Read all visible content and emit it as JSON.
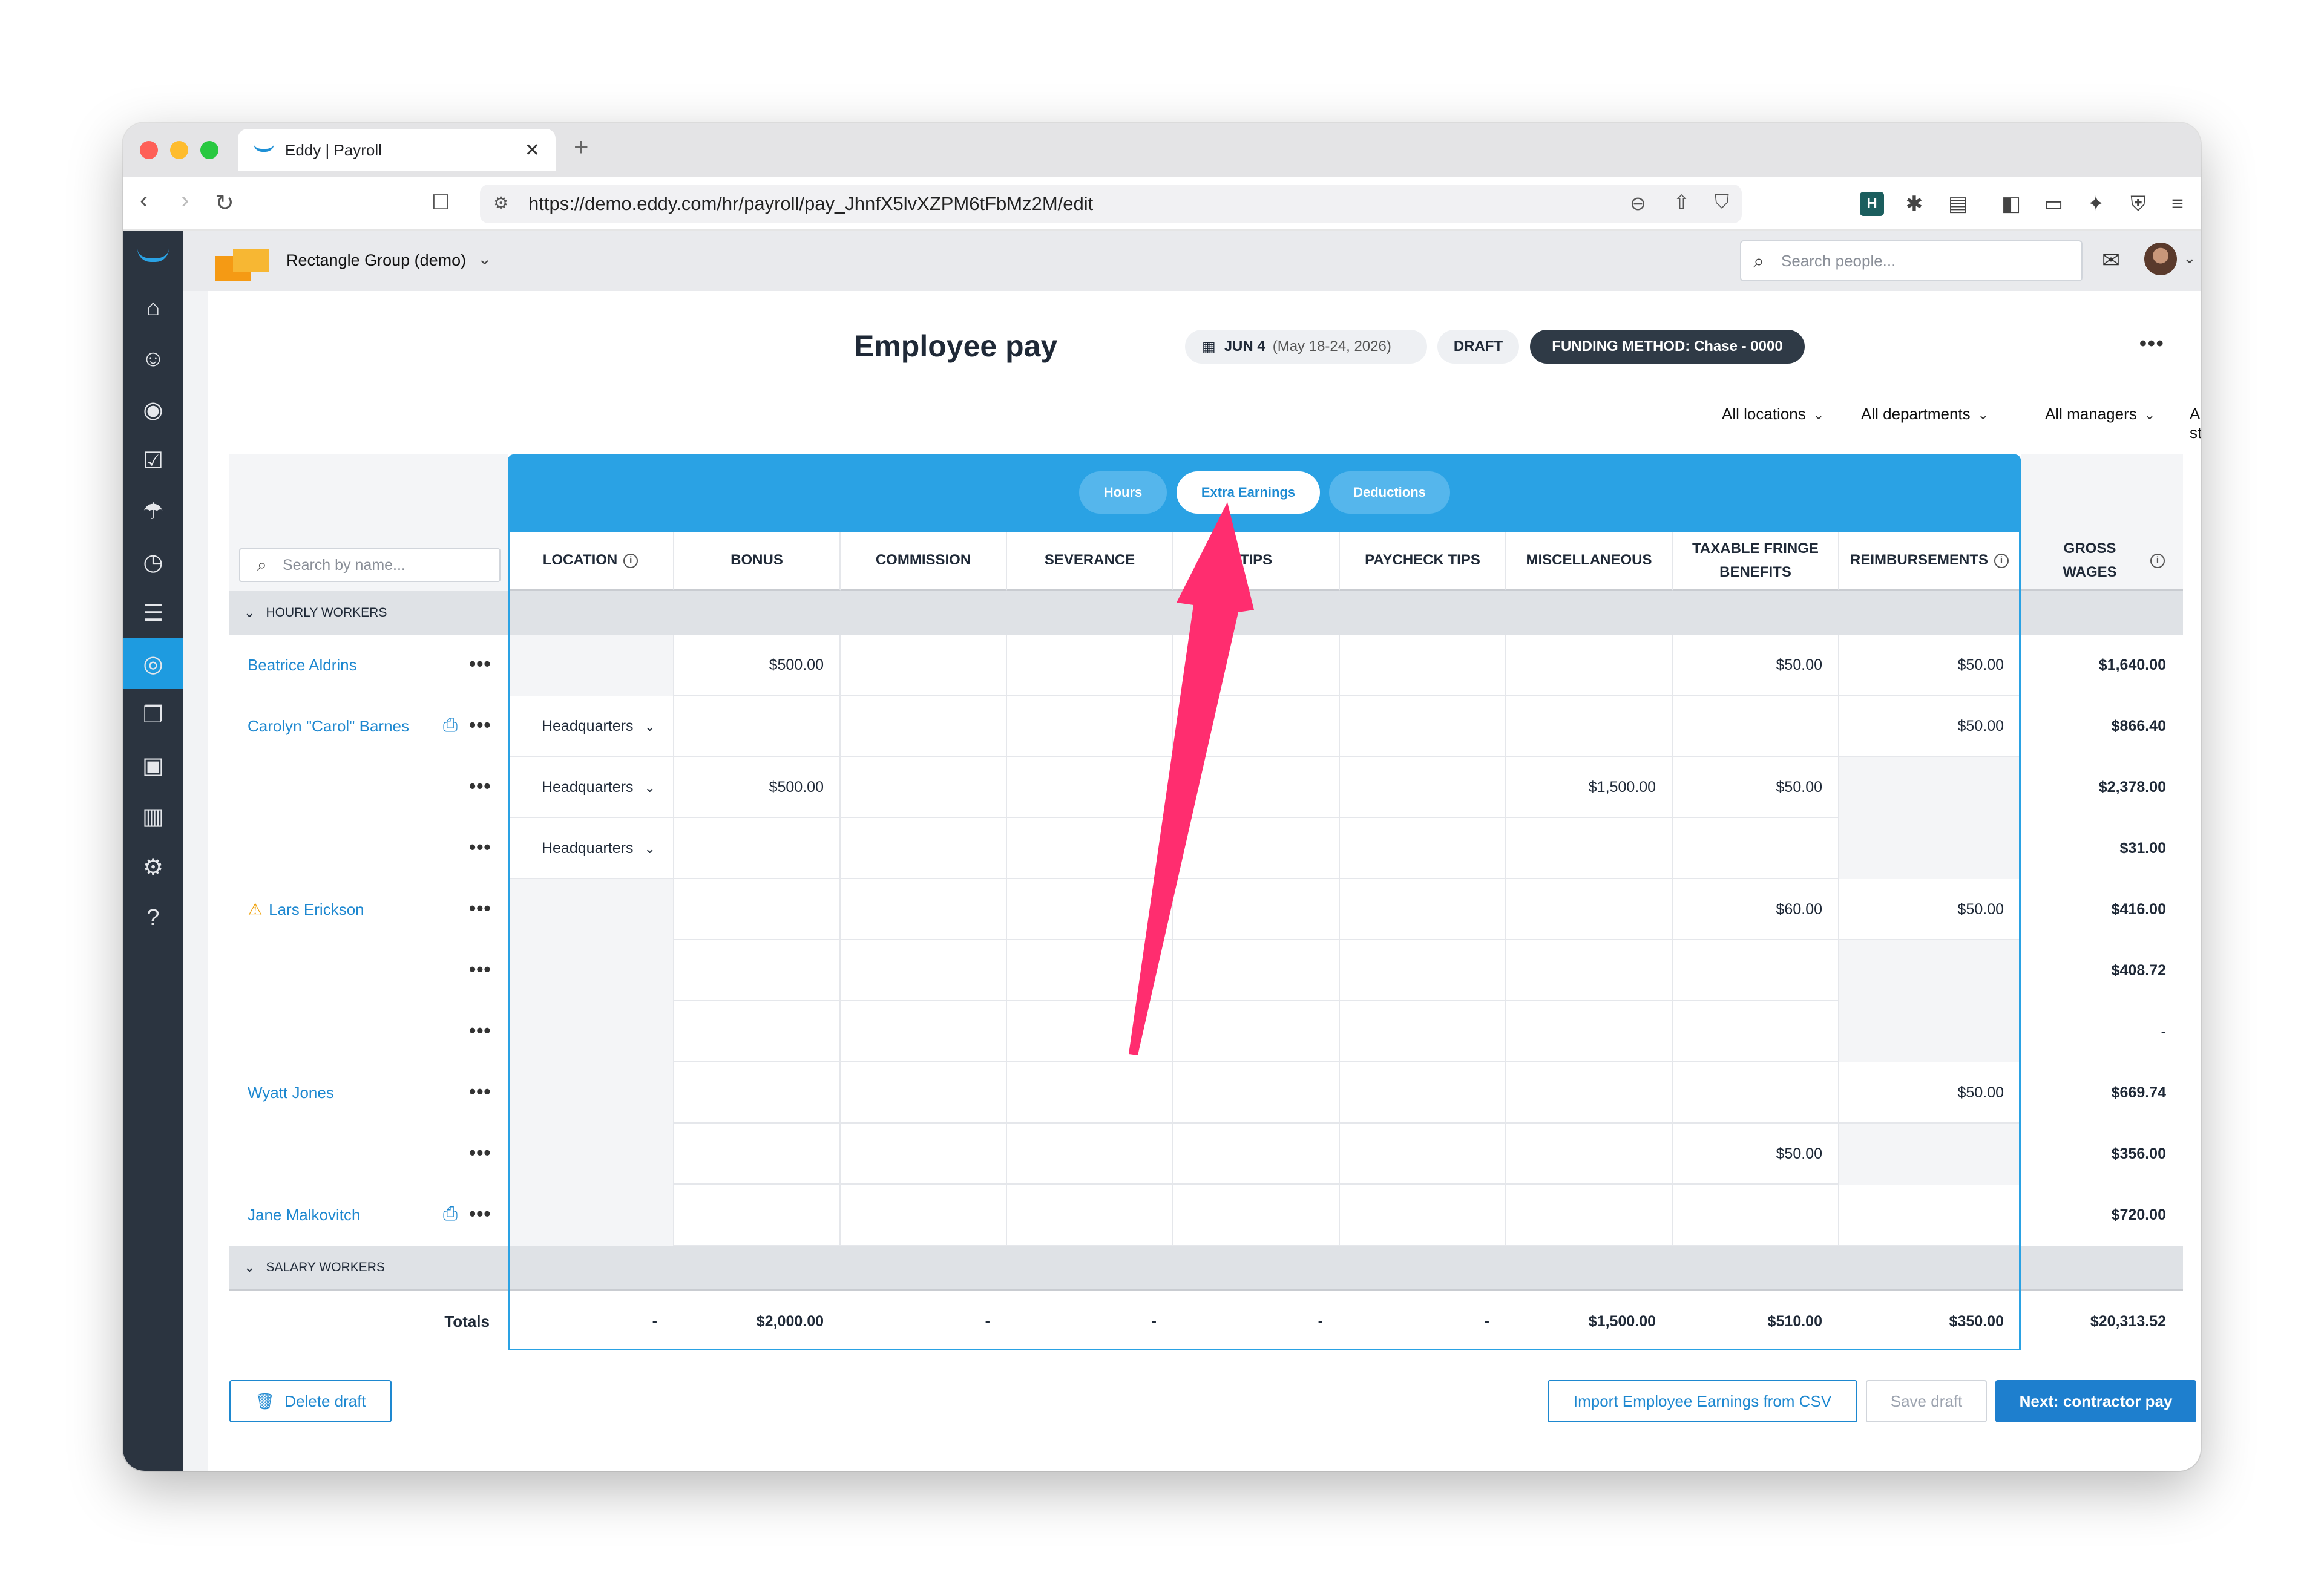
{
  "browser": {
    "tab_title": "Eddy | Payroll",
    "tab_close": "✕",
    "new_tab": "+",
    "url": "https://demo.eddy.com/hr/payroll/pay_JhnfX5lvXZPM6tFbMz2M/edit"
  },
  "topbar": {
    "org_name": "Rectangle Group (demo)",
    "search_placeholder": "Search people..."
  },
  "header": {
    "title": "Employee pay",
    "date_main": "JUN 4",
    "date_sub": "(May 18-24, 2026)",
    "status": "DRAFT",
    "funding": "FUNDING METHOD: Chase - 0000"
  },
  "filters": [
    "All locations",
    "All departments",
    "All managers",
    "All statuses"
  ],
  "segments": {
    "hours": "Hours",
    "extra_earnings": "Extra Earnings",
    "deductions": "Deductions"
  },
  "name_search_placeholder": "Search by name...",
  "columns": {
    "location": "LOCATION",
    "bonus": "BONUS",
    "commission": "COMMISSION",
    "severance": "SEVERANCE",
    "tips": "TIPS",
    "paycheck_tips": "PAYCHECK TIPS",
    "miscellaneous": "MISCELLANEOUS",
    "taxable_fringe_1": "TAXABLE FRINGE",
    "taxable_fringe_2": "BENEFITS",
    "reimbursements": "REIMBURSEMENTS",
    "gross_1": "GROSS",
    "gross_2": "WAGES"
  },
  "groups": {
    "hourly": "HOURLY WORKERS",
    "salary": "SALARY WORKERS"
  },
  "rows": [
    {
      "name": "Beatrice Aldrins",
      "location": "",
      "bonus": "$500.00",
      "misc": "",
      "fringe": "$50.00",
      "reimb": "$50.00",
      "gross": "$1,640.00"
    },
    {
      "name": "Carolyn \"Carol\" Barnes",
      "location": "Headquarters",
      "bonus": "",
      "misc": "",
      "fringe": "",
      "reimb": "$50.00",
      "gross": "$866.40"
    },
    {
      "name": "",
      "location": "Headquarters",
      "bonus": "$500.00",
      "misc": "$1,500.00",
      "fringe": "$50.00",
      "reimb": "",
      "gross": "$2,378.00"
    },
    {
      "name": "",
      "location": "Headquarters",
      "bonus": "",
      "misc": "",
      "fringe": "",
      "reimb": "",
      "gross": "$31.00"
    },
    {
      "name": "Lars Erickson",
      "location": "",
      "bonus": "",
      "misc": "",
      "fringe": "$60.00",
      "reimb": "$50.00",
      "gross": "$416.00"
    },
    {
      "name": "",
      "location": "",
      "bonus": "",
      "misc": "",
      "fringe": "",
      "reimb": "",
      "gross": "$408.72"
    },
    {
      "name": "",
      "location": "",
      "bonus": "",
      "misc": "",
      "fringe": "",
      "reimb": "",
      "gross": "-"
    },
    {
      "name": "Wyatt Jones",
      "location": "",
      "bonus": "",
      "misc": "",
      "fringe": "",
      "reimb": "$50.00",
      "gross": "$669.74"
    },
    {
      "name": "",
      "location": "",
      "bonus": "",
      "misc": "",
      "fringe": "$50.00",
      "reimb": "",
      "gross": "$356.00"
    },
    {
      "name": "Jane Malkovitch",
      "location": "",
      "bonus": "",
      "misc": "",
      "fringe": "",
      "reimb": "",
      "gross": "$720.00"
    }
  ],
  "totals": {
    "label": "Totals",
    "location": "-",
    "bonus": "$2,000.00",
    "commission": "-",
    "severance": "-",
    "tips": "-",
    "paycheck_tips": "-",
    "misc": "$1,500.00",
    "fringe": "$510.00",
    "reimb": "$350.00",
    "gross": "$20,313.52"
  },
  "footer": {
    "delete": "Delete draft",
    "import": "Import Employee Earnings from CSV",
    "save": "Save draft",
    "next": "Next: contractor pay"
  },
  "colors": {
    "accent": "#2aa2e4",
    "link": "#1e88d0",
    "sidebar": "#2b3440",
    "arrow": "#ff2d6f"
  }
}
